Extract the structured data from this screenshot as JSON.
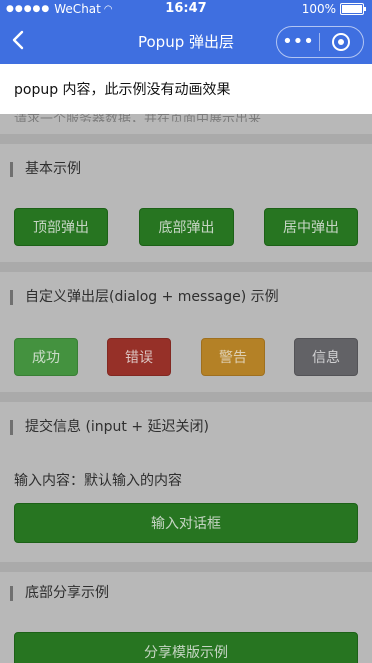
{
  "status_bar": {
    "carrier": "WeChat",
    "time": "16:47",
    "battery": "100%"
  },
  "nav": {
    "title": "Popup 弹出层",
    "more_label": "•••"
  },
  "popup": {
    "text": "popup 内容，此示例没有动画效果"
  },
  "sections": {
    "hidden_top_text": "请求一个服务器数据，并在页面中展示出来",
    "basic": {
      "title": "基本示例",
      "buttons": [
        "顶部弹出",
        "底部弹出",
        "居中弹出"
      ]
    },
    "custom": {
      "title": "自定义弹出层(dialog + message) 示例",
      "buttons": [
        "成功",
        "错误",
        "警告",
        "信息"
      ]
    },
    "submit": {
      "title": "提交信息 (input + 延迟关闭)",
      "input_label": "输入内容：",
      "input_value": "默认输入的内容",
      "button": "输入对话框"
    },
    "share": {
      "title": "底部分享示例",
      "button": "分享模版示例"
    }
  },
  "colors": {
    "nav_blue": "#3f6fe0",
    "primary_green": "#2b7f24",
    "success": "#4a9f45",
    "error": "#a3352c",
    "warning": "#c48d2a",
    "info": "#6b6b6f"
  }
}
